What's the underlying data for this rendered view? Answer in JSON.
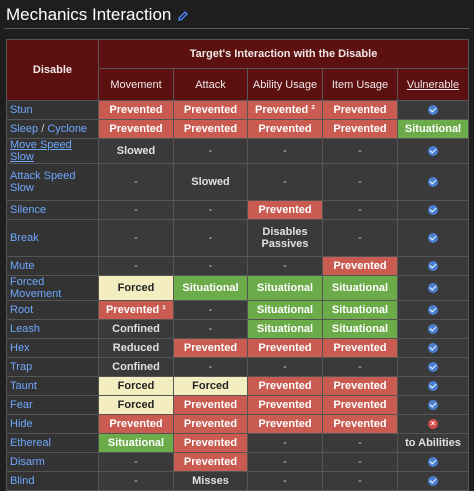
{
  "header": {
    "title": "Mechanics Interaction",
    "edit_icon": "pencil-icon"
  },
  "table": {
    "disable_label": "Disable",
    "group_label": "Target's Interaction with the Disable",
    "columns": [
      "Movement",
      "Attack",
      "Ability Usage",
      "Item Usage",
      "Vulnerable"
    ],
    "rows": [
      {
        "name": "Stun",
        "cells": [
          [
            "Prevented",
            "red"
          ],
          [
            "Prevented",
            "red"
          ],
          [
            "Prevented ²",
            "red"
          ],
          [
            "Prevented",
            "red"
          ],
          [
            "",
            "check"
          ]
        ]
      },
      {
        "name_parts": [
          "Sleep",
          " / ",
          "Cyclone"
        ],
        "cells": [
          [
            "Prevented",
            "red"
          ],
          [
            "Prevented",
            "red"
          ],
          [
            "Prevented",
            "red"
          ],
          [
            "Prevented",
            "red"
          ],
          [
            "Situational",
            "green"
          ]
        ]
      },
      {
        "name": "Move Speed Slow",
        "underline": true,
        "cells": [
          [
            "Slowed",
            "grey"
          ],
          [
            "-",
            "dash"
          ],
          [
            "-",
            "dash"
          ],
          [
            "-",
            "dash"
          ],
          [
            "",
            "check"
          ]
        ]
      },
      {
        "name": "Attack Speed Slow",
        "tall": true,
        "cells": [
          [
            "-",
            "dash"
          ],
          [
            "Slowed",
            "grey"
          ],
          [
            "-",
            "dash"
          ],
          [
            "-",
            "dash"
          ],
          [
            "",
            "check"
          ]
        ]
      },
      {
        "name": "Silence",
        "cells": [
          [
            "-",
            "dash"
          ],
          [
            "-",
            "dash"
          ],
          [
            "Prevented",
            "red"
          ],
          [
            "-",
            "dash"
          ],
          [
            "",
            "check"
          ]
        ]
      },
      {
        "name": "Break",
        "tall": true,
        "cells": [
          [
            "-",
            "dash"
          ],
          [
            "-",
            "dash"
          ],
          [
            "Disables Passives",
            "grey"
          ],
          [
            "-",
            "dash"
          ],
          [
            "",
            "check"
          ]
        ]
      },
      {
        "name": "Mute",
        "cells": [
          [
            "-",
            "dash"
          ],
          [
            "-",
            "dash"
          ],
          [
            "-",
            "dash"
          ],
          [
            "Prevented",
            "red"
          ],
          [
            "",
            "check"
          ]
        ]
      },
      {
        "name": "Forced Movement",
        "cells": [
          [
            "Forced",
            "yellow"
          ],
          [
            "Situational",
            "green"
          ],
          [
            "Situational",
            "green"
          ],
          [
            "Situational",
            "green"
          ],
          [
            "",
            "check"
          ]
        ]
      },
      {
        "name": "Root",
        "cells": [
          [
            "Prevented ¹",
            "red"
          ],
          [
            "-",
            "dash"
          ],
          [
            "Situational",
            "green"
          ],
          [
            "Situational",
            "green"
          ],
          [
            "",
            "check"
          ]
        ]
      },
      {
        "name": "Leash",
        "cells": [
          [
            "Confined",
            "grey"
          ],
          [
            "-",
            "dash"
          ],
          [
            "Situational",
            "green"
          ],
          [
            "Situational",
            "green"
          ],
          [
            "",
            "check"
          ]
        ]
      },
      {
        "name": "Hex",
        "cells": [
          [
            "Reduced",
            "grey"
          ],
          [
            "Prevented",
            "red"
          ],
          [
            "Prevented",
            "red"
          ],
          [
            "Prevented",
            "red"
          ],
          [
            "",
            "check"
          ]
        ]
      },
      {
        "name": "Trap",
        "cells": [
          [
            "Confined",
            "grey"
          ],
          [
            "-",
            "dash"
          ],
          [
            "-",
            "dash"
          ],
          [
            "-",
            "dash"
          ],
          [
            "",
            "check"
          ]
        ]
      },
      {
        "name": "Taunt",
        "cells": [
          [
            "Forced",
            "yellow"
          ],
          [
            "Forced",
            "yellow"
          ],
          [
            "Prevented",
            "red"
          ],
          [
            "Prevented",
            "red"
          ],
          [
            "",
            "check"
          ]
        ]
      },
      {
        "name": "Fear",
        "cells": [
          [
            "Forced",
            "yellow"
          ],
          [
            "Prevented",
            "red"
          ],
          [
            "Prevented",
            "red"
          ],
          [
            "Prevented",
            "red"
          ],
          [
            "",
            "check"
          ]
        ]
      },
      {
        "name": "Hide",
        "cells": [
          [
            "Prevented",
            "red"
          ],
          [
            "Prevented",
            "red"
          ],
          [
            "Prevented",
            "red"
          ],
          [
            "Prevented",
            "red"
          ],
          [
            "",
            "cross"
          ]
        ]
      },
      {
        "name": "Ethereal",
        "cells": [
          [
            "Situational",
            "green"
          ],
          [
            "Prevented",
            "red"
          ],
          [
            "-",
            "dash"
          ],
          [
            "-",
            "dash"
          ],
          [
            "to Abilities",
            "grey"
          ]
        ]
      },
      {
        "name": "Disarm",
        "cells": [
          [
            "-",
            "dash"
          ],
          [
            "Prevented",
            "red"
          ],
          [
            "-",
            "dash"
          ],
          [
            "-",
            "dash"
          ],
          [
            "",
            "check"
          ]
        ]
      },
      {
        "name": "Blind",
        "cells": [
          [
            "-",
            "dash"
          ],
          [
            "Misses",
            "grey"
          ],
          [
            "-",
            "dash"
          ],
          [
            "-",
            "dash"
          ],
          [
            "",
            "check"
          ]
        ]
      }
    ]
  }
}
